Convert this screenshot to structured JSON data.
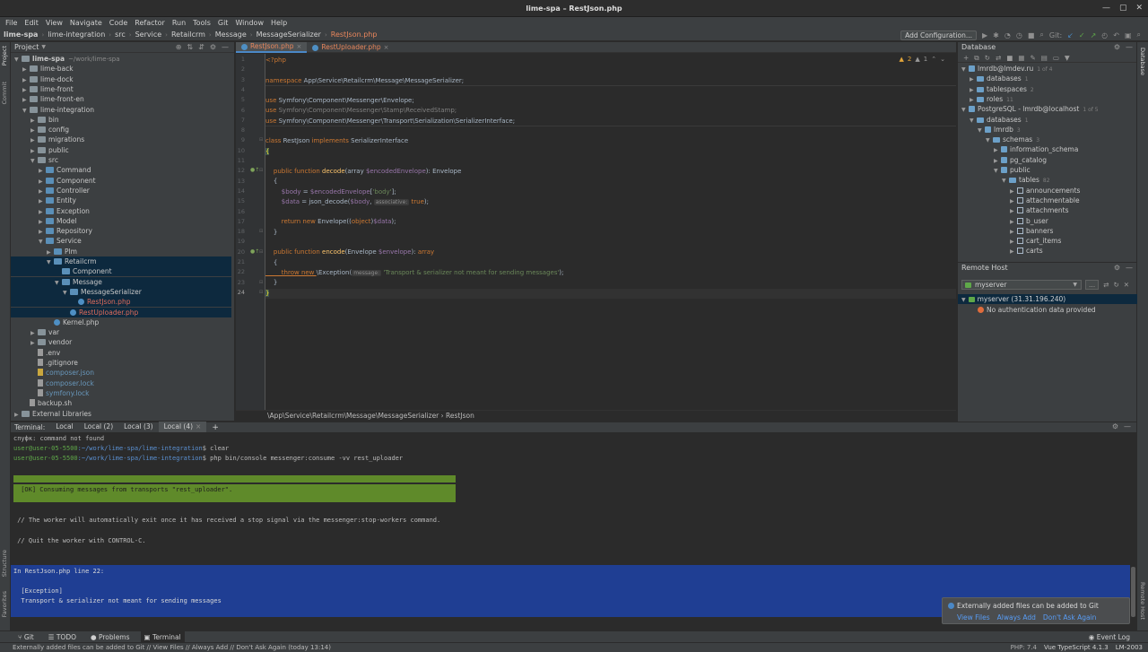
{
  "window": {
    "title": "lime-spa – RestJson.php"
  },
  "menu": [
    "File",
    "Edit",
    "View",
    "Navigate",
    "Code",
    "Refactor",
    "Run",
    "Tools",
    "Git",
    "Window",
    "Help"
  ],
  "breadcrumbs": [
    "lime-spa",
    "lime-integration",
    "src",
    "Service",
    "Retailcrm",
    "Message",
    "MessageSerializer",
    "RestJson.php"
  ],
  "toolbar": {
    "add_configuration": "Add Configuration...",
    "git_label": "Git:"
  },
  "left_strip": {
    "project": "Project",
    "commit": "Commit",
    "structure": "Structure",
    "favorites": "Favorites"
  },
  "right_strip": {
    "database": "Database",
    "remote_host": "Remote Host"
  },
  "project": {
    "title": "Project",
    "tree": [
      {
        "label": "lime-spa",
        "extra": "~/work/lime-spa",
        "depth": 0,
        "type": "folder",
        "arrow": "down",
        "bold": true
      },
      {
        "label": "lime-back",
        "depth": 1,
        "type": "folder",
        "arrow": "right"
      },
      {
        "label": "lime-dock",
        "depth": 1,
        "type": "folder",
        "arrow": "right"
      },
      {
        "label": "lime-front",
        "depth": 1,
        "type": "folder",
        "arrow": "right"
      },
      {
        "label": "lime-front-en",
        "depth": 1,
        "type": "folder",
        "arrow": "right"
      },
      {
        "label": "lime-integration",
        "depth": 1,
        "type": "folder",
        "arrow": "down"
      },
      {
        "label": "bin",
        "depth": 2,
        "type": "folder",
        "arrow": "right"
      },
      {
        "label": "config",
        "depth": 2,
        "type": "folder",
        "arrow": "right"
      },
      {
        "label": "migrations",
        "depth": 2,
        "type": "folder",
        "arrow": "right"
      },
      {
        "label": "public",
        "depth": 2,
        "type": "folder",
        "arrow": "right"
      },
      {
        "label": "src",
        "depth": 2,
        "type": "folder",
        "arrow": "down"
      },
      {
        "label": "Command",
        "depth": 3,
        "type": "folder",
        "arrow": "right"
      },
      {
        "label": "Component",
        "depth": 3,
        "type": "folder",
        "arrow": "right"
      },
      {
        "label": "Controller",
        "depth": 3,
        "type": "folder",
        "arrow": "right"
      },
      {
        "label": "Entity",
        "depth": 3,
        "type": "folder",
        "arrow": "right"
      },
      {
        "label": "Exception",
        "depth": 3,
        "type": "folder",
        "arrow": "right"
      },
      {
        "label": "Model",
        "depth": 3,
        "type": "folder",
        "arrow": "right"
      },
      {
        "label": "Repository",
        "depth": 3,
        "type": "folder",
        "arrow": "right"
      },
      {
        "label": "Service",
        "depth": 3,
        "type": "folder",
        "arrow": "down"
      },
      {
        "label": "Plm",
        "depth": 4,
        "type": "folder",
        "arrow": "right"
      },
      {
        "label": "Retailcrm",
        "depth": 4,
        "type": "folder",
        "arrow": "down",
        "sel": true
      },
      {
        "label": "Component",
        "depth": 5,
        "type": "folder",
        "arrow": "",
        "sel": true
      },
      {
        "label": "Message",
        "depth": 5,
        "type": "folder",
        "arrow": "down",
        "sel": true
      },
      {
        "label": "MessageSerializer",
        "depth": 6,
        "type": "folder",
        "arrow": "down",
        "sel": true
      },
      {
        "label": "RestJson.php",
        "depth": 7,
        "type": "php",
        "arrow": "",
        "sel": true,
        "color": "red"
      },
      {
        "label": "RestUploader.php",
        "depth": 6,
        "type": "php",
        "arrow": "",
        "sel": true,
        "color": "red"
      },
      {
        "label": "Kernel.php",
        "depth": 4,
        "type": "php",
        "arrow": ""
      },
      {
        "label": "var",
        "depth": 2,
        "type": "folder",
        "arrow": "right"
      },
      {
        "label": "vendor",
        "depth": 2,
        "type": "folder",
        "arrow": "right"
      },
      {
        "label": ".env",
        "depth": 2,
        "type": "file",
        "arrow": ""
      },
      {
        "label": ".gitignore",
        "depth": 2,
        "type": "file",
        "arrow": ""
      },
      {
        "label": "composer.json",
        "depth": 2,
        "type": "json",
        "arrow": "",
        "color": "blue"
      },
      {
        "label": "composer.lock",
        "depth": 2,
        "type": "file",
        "arrow": "",
        "color": "blue"
      },
      {
        "label": "symfony.lock",
        "depth": 2,
        "type": "file",
        "arrow": "",
        "color": "blue"
      },
      {
        "label": "backup.sh",
        "depth": 1,
        "type": "file",
        "arrow": ""
      },
      {
        "label": "External Libraries",
        "depth": 0,
        "type": "lib",
        "arrow": "right"
      }
    ]
  },
  "editor": {
    "tabs": [
      {
        "label": "RestJson.php",
        "active": true
      },
      {
        "label": "RestUploader.php",
        "active": false
      }
    ],
    "inspections": {
      "warnings": "2",
      "infos": "1"
    },
    "breadcrumb": "\\App\\Service\\Retailcrm\\Message\\MessageSerializer   ›   RestJson",
    "line_numbers": [
      "1",
      "2",
      "3",
      "4",
      "5",
      "6",
      "7",
      "8",
      "9",
      "10",
      "11",
      "12",
      "13",
      "14",
      "15",
      "16",
      "17",
      "18",
      "19",
      "20",
      "21",
      "22",
      "23",
      "24"
    ],
    "code": {
      "l1": "<?php",
      "l3_kw": "namespace",
      "l3_rest": " App\\Service\\Retailcrm\\Message\\MessageSerializer;",
      "l5_kw": "use",
      "l5_rest": " Symfony\\Component\\Messenger\\Envelope;",
      "l6_kw": "use",
      "l6_rest": " Symfony\\Component\\Messenger\\Stamp\\ReceivedStamp;",
      "l7_kw": "use",
      "l7_rest": " Symfony\\Component\\Messenger\\Transport\\Serialization\\SerializerInterface;",
      "l9_kw1": "class",
      "l9_name": " RestJson ",
      "l9_kw2": "implements",
      "l9_iface": " SerializerInterface",
      "l10": "{",
      "l12_kw": "    public function ",
      "l12_fn": "decode",
      "l12_a": "(array ",
      "l12_var": "$encodedEnvelope",
      "l12_b": "): Envelope",
      "l13": "    {",
      "l14_var": "        $body",
      "l14_a": " = ",
      "l14_var2": "$encodedEnvelope",
      "l14_b": "[",
      "l14_str": "'body'",
      "l14_c": "];",
      "l15_var": "        $data",
      "l15_a": " = json_decode(",
      "l15_var2": "$body",
      "l15_b": ", ",
      "l15_hint": "associative:",
      "l15_kw": " true",
      "l15_c": ");",
      "l17_kw": "        return new ",
      "l17_a": "Envelope((",
      "l17_kw2": "object",
      "l17_b": ")",
      "l17_var": "$data",
      "l17_c": ");",
      "l18": "    }",
      "l20_kw": "    public function ",
      "l20_fn": "encode",
      "l20_a": "(Envelope ",
      "l20_var": "$envelope",
      "l20_b": "): ",
      "l20_kw2": "array",
      "l21": "    {",
      "l22_kw": "        throw new ",
      "l22_a": "\\Exception(",
      "l22_hint": "message:",
      "l22_str": " 'Transport & serializer not meant for sending messages'",
      "l22_b": ");",
      "l23": "    }",
      "l24": "}"
    }
  },
  "database": {
    "title": "Database",
    "tree": [
      {
        "label": "lmrdb@lmdev.ru",
        "count": "1 of 4",
        "depth": 0,
        "type": "db",
        "arrow": "down"
      },
      {
        "label": "databases",
        "count": "1",
        "depth": 1,
        "type": "fold",
        "arrow": "right"
      },
      {
        "label": "tablespaces",
        "count": "2",
        "depth": 1,
        "type": "fold",
        "arrow": "right"
      },
      {
        "label": "roles",
        "count": "11",
        "depth": 1,
        "type": "fold",
        "arrow": "right"
      },
      {
        "label": "PostgreSQL - lmrdb@localhost",
        "count": "1 of 5",
        "depth": 0,
        "type": "db",
        "arrow": "down"
      },
      {
        "label": "databases",
        "count": "1",
        "depth": 1,
        "type": "fold",
        "arrow": "down"
      },
      {
        "label": "lmrdb",
        "count": "3",
        "depth": 2,
        "type": "db",
        "arrow": "down"
      },
      {
        "label": "schemas",
        "count": "3",
        "depth": 3,
        "type": "fold",
        "arrow": "down"
      },
      {
        "label": "information_schema",
        "count": "",
        "depth": 4,
        "type": "db",
        "arrow": "right"
      },
      {
        "label": "pg_catalog",
        "count": "",
        "depth": 4,
        "type": "db",
        "arrow": "right"
      },
      {
        "label": "public",
        "count": "",
        "depth": 4,
        "type": "db",
        "arrow": "down"
      },
      {
        "label": "tables",
        "count": "82",
        "depth": 5,
        "type": "fold",
        "arrow": "down"
      },
      {
        "label": "announcements",
        "count": "",
        "depth": 6,
        "type": "tbl",
        "arrow": "right"
      },
      {
        "label": "attachmentable",
        "count": "",
        "depth": 6,
        "type": "tbl",
        "arrow": "right"
      },
      {
        "label": "attachments",
        "count": "",
        "depth": 6,
        "type": "tbl",
        "arrow": "right"
      },
      {
        "label": "b_user",
        "count": "",
        "depth": 6,
        "type": "tbl",
        "arrow": "right"
      },
      {
        "label": "banners",
        "count": "",
        "depth": 6,
        "type": "tbl",
        "arrow": "right"
      },
      {
        "label": "cart_items",
        "count": "",
        "depth": 6,
        "type": "tbl",
        "arrow": "right"
      },
      {
        "label": "carts",
        "count": "",
        "depth": 6,
        "type": "tbl",
        "arrow": "right"
      }
    ]
  },
  "remote_host": {
    "title": "Remote Host",
    "selected_server": "myserver",
    "server_row": "myserver (31.31.196.240)",
    "message": "No authentication data provided"
  },
  "terminal": {
    "label": "Terminal:",
    "tabs": [
      {
        "label": "Local",
        "active": false
      },
      {
        "label": "Local (2)",
        "active": false
      },
      {
        "label": "Local (3)",
        "active": false
      },
      {
        "label": "Local (4)",
        "active": true
      }
    ],
    "line1": "спуфк: command not found",
    "line2_user": "user@user-05-5500",
    "line2_path": ":~/work/lime-spa/lime-integration",
    "line2_cmd": "$ clear",
    "line3_user": "user@user-05-5500",
    "line3_path": ":~/work/lime-spa/lime-integration",
    "line3_cmd": "$ php bin/console messenger:consume -vv rest_uploader",
    "ok": " [OK] Consuming messages from transports \"rest_uploader\".",
    "note1": " // The worker will automatically exit once it has received a stop signal via the messenger:stop-workers command.",
    "note2": " // Quit the worker with CONTROL-C.",
    "err1": "In RestJson.php line 22:",
    "err2": "  [Exception]",
    "err3": "  Transport & serializer not meant for sending messages"
  },
  "notification": {
    "message": "Externally added files can be added to Git",
    "links": [
      "View Files",
      "Always Add",
      "Don't Ask Again"
    ]
  },
  "bottom_tools": [
    "Git",
    "TODO",
    "Problems",
    "Terminal"
  ],
  "event_log": "Event Log",
  "status": {
    "message": "Externally added files can be added to Git // View Files // Always Add // Don't Ask Again (today 13:14)",
    "php": "PHP: 7.4",
    "ts": "Vue TypeScript 4.1.3",
    "branch": "LM-2003"
  }
}
